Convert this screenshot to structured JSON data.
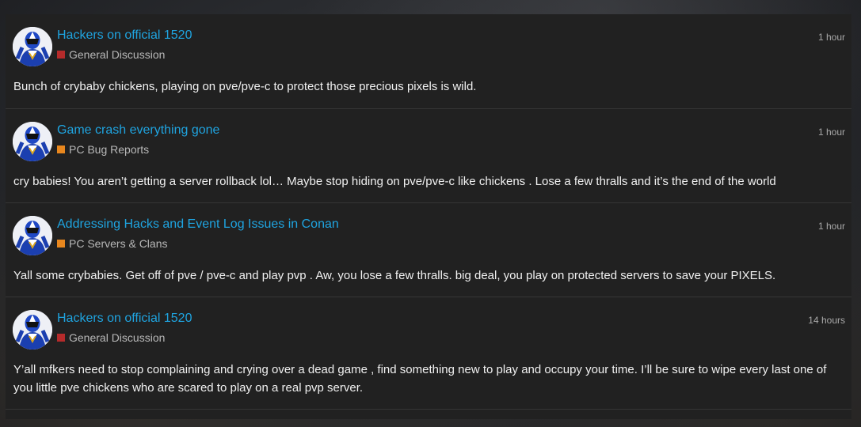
{
  "posts": [
    {
      "title": "Hackers on official 1520",
      "category": "General Discussion",
      "category_color": "#b52b2b",
      "time": "1 hour",
      "excerpt": "Bunch of crybaby chickens, playing on pve/pve-c to protect those precious pixels is wild."
    },
    {
      "title": "Game crash everything gone",
      "category": "PC Bug Reports",
      "category_color": "#e8871e",
      "time": "1 hour",
      "excerpt": "cry babies! You aren’t getting a server rollback lol… Maybe stop hiding on pve/pve-c like chickens . Lose a few thralls and it’s the end of the world"
    },
    {
      "title": "Addressing Hacks and Event Log Issues in Conan",
      "category": "PC Servers & Clans",
      "category_color": "#e8871e",
      "time": "1 hour",
      "excerpt": "Yall some crybabies. Get off of pve / pve-c and play pvp . Aw, you lose a few thralls. big deal, you play on protected servers to save your PIXELS."
    },
    {
      "title": "Hackers on official 1520",
      "category": "General Discussion",
      "category_color": "#b52b2b",
      "time": "14 hours",
      "excerpt": "Y’all mfkers need to stop complaining and crying over a dead game , find something new to play and occupy your time. I’ll be sure to wipe every last one of you little pve chickens who are scared to play on a real pvp server."
    }
  ]
}
